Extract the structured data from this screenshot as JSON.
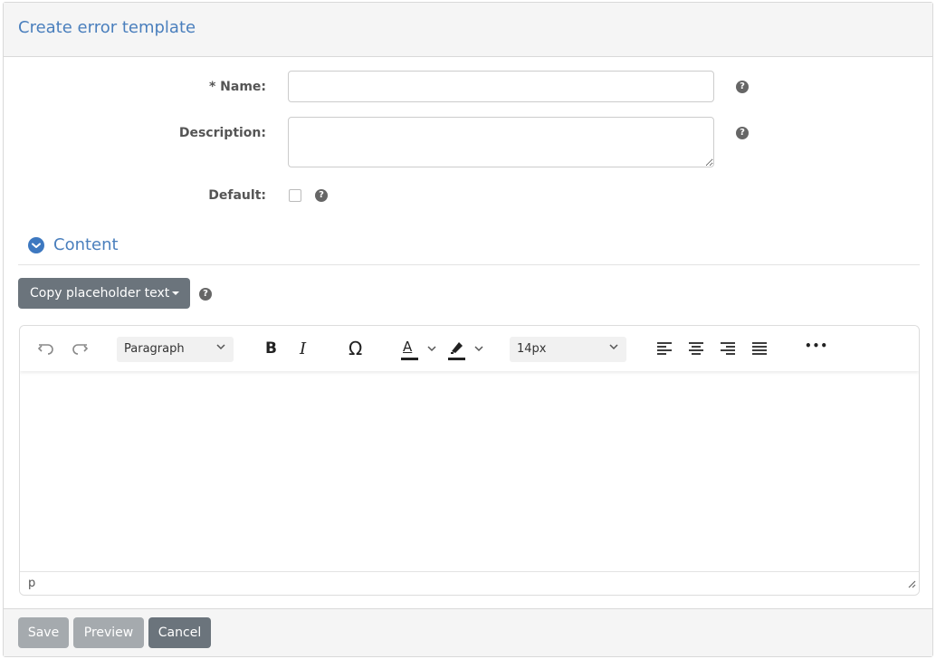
{
  "header": {
    "title": "Create error template"
  },
  "form": {
    "name": {
      "label": "* Name:",
      "value": "",
      "placeholder": ""
    },
    "description": {
      "label": "Description:",
      "value": "",
      "placeholder": ""
    },
    "default": {
      "label": "Default:",
      "checked": false
    },
    "help_glyph": "?"
  },
  "content": {
    "title": "Content",
    "copy_button_label": "Copy placeholder text"
  },
  "editor": {
    "block_format": "Paragraph",
    "font_size": "14px",
    "status_path": "p",
    "text_color_glyph": "A",
    "omega_glyph": "Ω",
    "bold_glyph": "B",
    "italic_glyph": "I",
    "more_glyph": "•••"
  },
  "footer": {
    "save_label": "Save",
    "preview_label": "Preview",
    "cancel_label": "Cancel"
  },
  "colors": {
    "accent": "#4a7fbd",
    "button_dark": "#6b747c",
    "button_disabled": "#a5aaae"
  }
}
